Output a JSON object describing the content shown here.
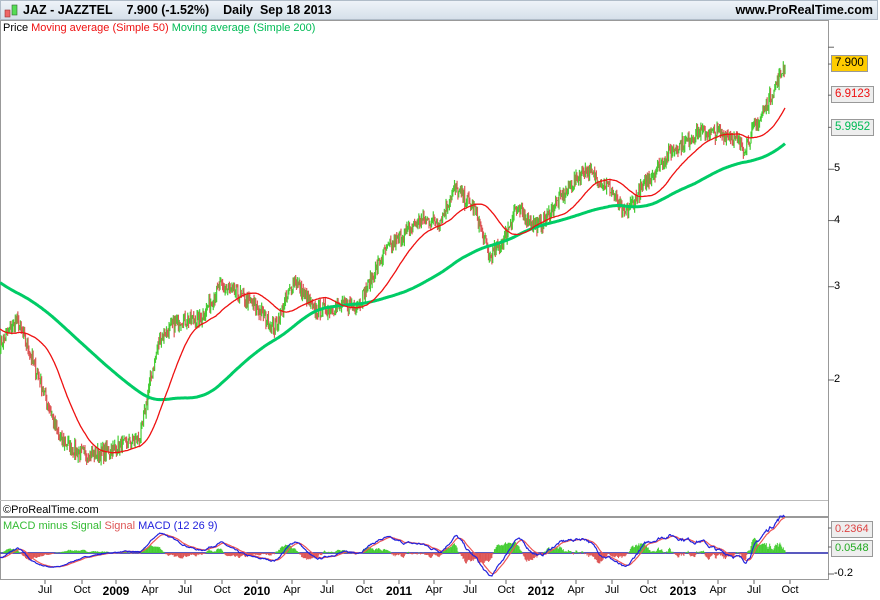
{
  "header": {
    "title": "JAZ - JAZZTEL",
    "price": "7.900 (-1.52%)",
    "period": "Daily",
    "date": "Sep 18 2013",
    "site": "www.ProRealTime.com"
  },
  "legend": {
    "price": "Price",
    "ma50": "Moving average (Simple 50)",
    "ma200": "Moving average (Simple 200)"
  },
  "copyright": "©ProRealTime.com",
  "macd_legend": {
    "hist": "MACD minus Signal",
    "signal": "Signal",
    "macd": "MACD (12 26 9)"
  },
  "colors": {
    "up": "#44cc33",
    "down": "#dd5555",
    "ma50": "#ee1111",
    "ma200": "#00cc66",
    "macd": "#2222dd",
    "signal": "#ee5555"
  },
  "chart_data": {
    "type": "line",
    "scale": "log",
    "y_ticks": [
      "5",
      "4",
      "3",
      "2"
    ],
    "y_tick_values": [
      5,
      4,
      3,
      2
    ],
    "last_values": {
      "price": "7.900",
      "ma50": "6.9123",
      "ma200": "5.9952"
    },
    "price_keypoints_day_price": [
      [
        0,
        2.33
      ],
      [
        20,
        2.6
      ],
      [
        47,
        2.0
      ],
      [
        70,
        1.55
      ],
      [
        94,
        1.45
      ],
      [
        118,
        1.45
      ],
      [
        141,
        1.5
      ],
      [
        165,
        1.55
      ],
      [
        177,
        2.0
      ],
      [
        188,
        2.4
      ],
      [
        212,
        2.6
      ],
      [
        235,
        2.6
      ],
      [
        259,
        3.0
      ],
      [
        282,
        2.9
      ],
      [
        306,
        2.7
      ],
      [
        323,
        2.5
      ],
      [
        347,
        3.1
      ],
      [
        370,
        2.7
      ],
      [
        400,
        2.75
      ],
      [
        423,
        2.8
      ],
      [
        453,
        3.5
      ],
      [
        494,
        4.0
      ],
      [
        518,
        4.0
      ],
      [
        535,
        4.6
      ],
      [
        559,
        4.2
      ],
      [
        576,
        3.4
      ],
      [
        594,
        3.7
      ],
      [
        606,
        4.2
      ],
      [
        635,
        3.9
      ],
      [
        659,
        4.4
      ],
      [
        688,
        5.0
      ],
      [
        718,
        4.6
      ],
      [
        735,
        4.1
      ],
      [
        759,
        4.7
      ],
      [
        788,
        5.4
      ],
      [
        824,
        5.9
      ],
      [
        859,
        5.8
      ],
      [
        876,
        5.5
      ],
      [
        894,
        6.2
      ],
      [
        906,
        6.8
      ],
      [
        924,
        7.9
      ]
    ],
    "macd": {
      "ticks": [
        "-0.2"
      ],
      "last_macd": "0.2364",
      "last_hist": "0.0548"
    },
    "x_ticks": [
      "Jul",
      "Oct",
      "2009",
      "Apr",
      "Jul",
      "Oct",
      "2010",
      "Apr",
      "Jul",
      "Oct",
      "2011",
      "Apr",
      "Jul",
      "Oct",
      "2012",
      "Apr",
      "Jul",
      "Oct",
      "2013",
      "Apr",
      "Jul",
      "Oct"
    ]
  }
}
